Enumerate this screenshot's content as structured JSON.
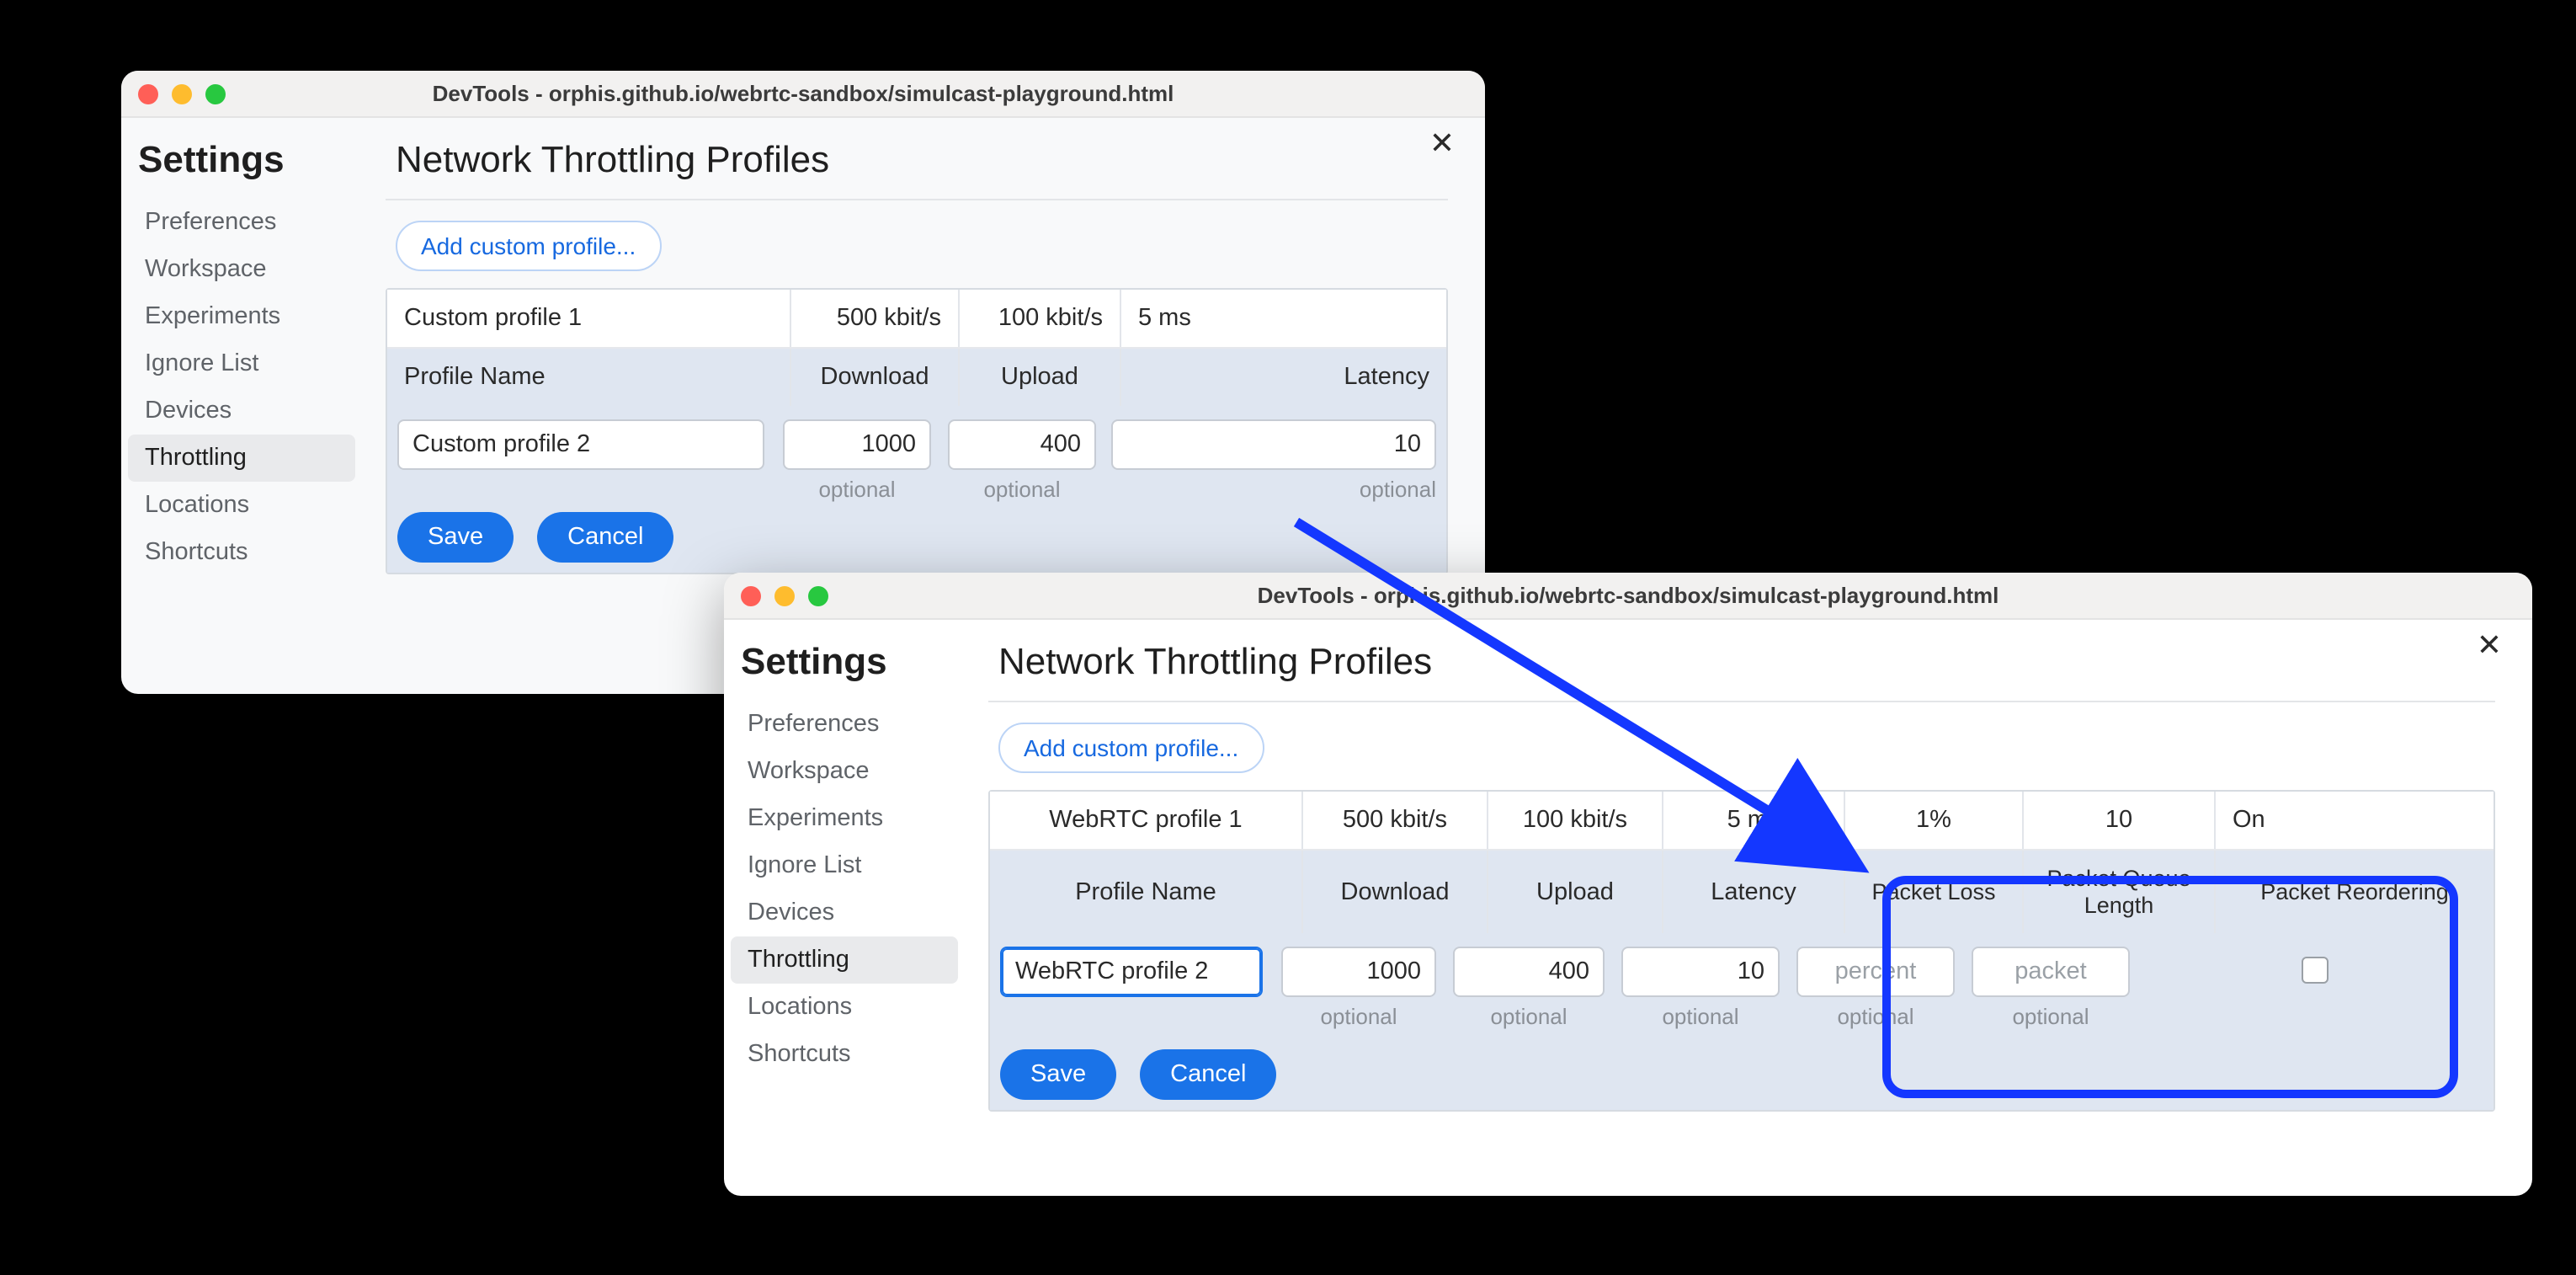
{
  "window_title": "DevTools - orphis.github.io/webrtc-sandbox/simulcast-playground.html",
  "sidebar_title": "Settings",
  "sidebar_items": [
    "Preferences",
    "Workspace",
    "Experiments",
    "Ignore List",
    "Devices",
    "Throttling",
    "Locations",
    "Shortcuts"
  ],
  "page_title": "Network Throttling Profiles",
  "add_profile_label": "Add custom profile...",
  "columns_a": {
    "name": "Profile Name",
    "download": "Download",
    "upload": "Upload",
    "latency": "Latency"
  },
  "columns_b": {
    "name": "Profile Name",
    "download": "Download",
    "upload": "Upload",
    "latency": "Latency",
    "packet_loss": "Packet Loss",
    "packet_queue": "Packet Queue Length",
    "packet_reorder": "Packet Reordering"
  },
  "optional_label": "optional",
  "save_label": "Save",
  "cancel_label": "Cancel",
  "a": {
    "row": {
      "name": "Custom profile 1",
      "download": "500 kbit/s",
      "upload": "100 kbit/s",
      "latency": "5 ms"
    },
    "edit": {
      "name": "Custom profile 2",
      "download": "1000",
      "upload": "400",
      "latency": "10"
    }
  },
  "b": {
    "row": {
      "name": "WebRTC profile 1",
      "download": "500 kbit/s",
      "upload": "100 kbit/s",
      "latency": "5 ms",
      "packet_loss": "1%",
      "packet_queue": "10",
      "packet_reorder": "On"
    },
    "edit": {
      "name": "WebRTC profile 2",
      "download": "1000",
      "upload": "400",
      "latency": "10",
      "packet_loss_ph": "percent",
      "packet_queue_ph": "packet"
    }
  }
}
